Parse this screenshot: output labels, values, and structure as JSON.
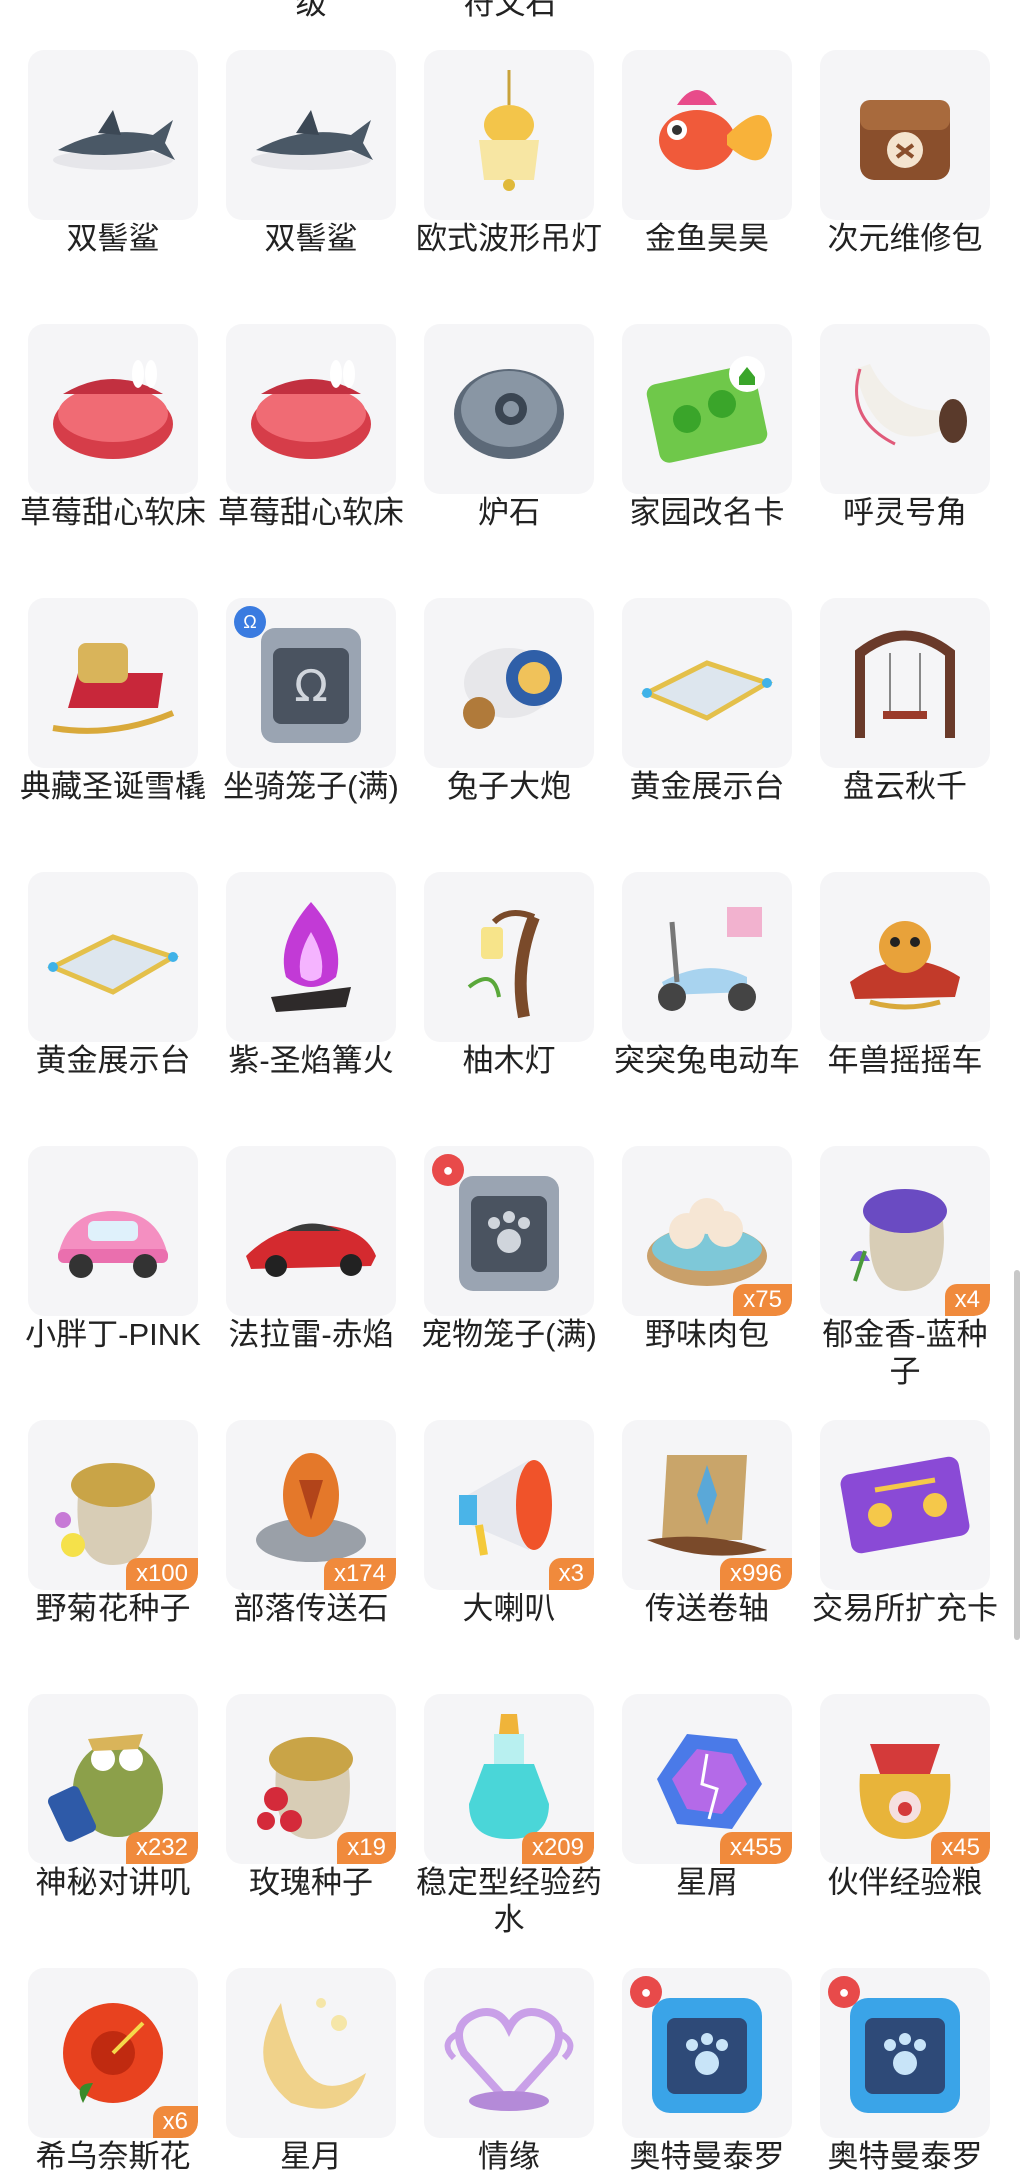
{
  "header_partial": {
    "left": "级",
    "middle": "符文石"
  },
  "items": [
    {
      "name": "双髻鲨",
      "icon": "shark-icon"
    },
    {
      "name": "双髻鲨",
      "icon": "shark-icon"
    },
    {
      "name": "欧式波形吊灯",
      "icon": "chandelier-icon"
    },
    {
      "name": "金鱼昊昊",
      "icon": "goldfish-icon"
    },
    {
      "name": "次元维修包",
      "icon": "repair-bag-icon"
    },
    {
      "name": "草莓甜心软床",
      "icon": "strawberry-bed-icon"
    },
    {
      "name": "草莓甜心软床",
      "icon": "strawberry-bed-icon"
    },
    {
      "name": "炉石",
      "icon": "hearthstone-icon"
    },
    {
      "name": "家园改名卡",
      "icon": "rename-card-icon"
    },
    {
      "name": "呼灵号角",
      "icon": "horn-icon"
    },
    {
      "name": "典藏圣诞雪橇",
      "icon": "sleigh-icon"
    },
    {
      "name": "坐骑笼子(满)",
      "icon": "mount-cage-icon",
      "corner": "mount"
    },
    {
      "name": "兔子大炮",
      "icon": "cannon-icon"
    },
    {
      "name": "黄金展示台",
      "icon": "display-stand-icon"
    },
    {
      "name": "盘云秋千",
      "icon": "swing-icon"
    },
    {
      "name": "黄金展示台",
      "icon": "display-stand-icon"
    },
    {
      "name": "紫-圣焰篝火",
      "icon": "bonfire-icon"
    },
    {
      "name": "柚木灯",
      "icon": "teak-lamp-icon"
    },
    {
      "name": "突突兔电动车",
      "icon": "scooter-icon"
    },
    {
      "name": "年兽摇摇车",
      "icon": "rocking-car-icon"
    },
    {
      "name": "小胖丁-PINK",
      "icon": "pink-car-icon"
    },
    {
      "name": "法拉雷-赤焰",
      "icon": "red-sportscar-icon"
    },
    {
      "name": "宠物笼子(满)",
      "icon": "pet-cage-icon",
      "corner": "pet"
    },
    {
      "name": "野味肉包",
      "icon": "steamed-bun-icon",
      "badge": "x75"
    },
    {
      "name": "郁金香-蓝种子",
      "icon": "tulip-seed-bag-icon",
      "badge": "x4"
    },
    {
      "name": "野菊花种子",
      "icon": "chrysanthemum-seed-bag-icon",
      "badge": "x100"
    },
    {
      "name": "部落传送石",
      "icon": "teleport-stone-icon",
      "badge": "x174"
    },
    {
      "name": "大喇叭",
      "icon": "megaphone-icon",
      "badge": "x3"
    },
    {
      "name": "传送卷轴",
      "icon": "scroll-icon",
      "badge": "x996"
    },
    {
      "name": "交易所扩充卡",
      "icon": "exchange-card-icon"
    },
    {
      "name": "神秘对讲叽",
      "icon": "walkie-talkie-bird-icon",
      "badge": "x232"
    },
    {
      "name": "玫瑰种子",
      "icon": "rose-seed-bag-icon",
      "badge": "x19"
    },
    {
      "name": "稳定型经验药水",
      "icon": "potion-icon",
      "badge": "x209"
    },
    {
      "name": "星屑",
      "icon": "stardust-icon",
      "badge": "x455"
    },
    {
      "name": "伙伴经验粮",
      "icon": "food-bag-icon",
      "badge": "x45"
    },
    {
      "name": "希乌奈斯花",
      "icon": "hibiscus-icon",
      "badge": "x6"
    },
    {
      "name": "星月",
      "icon": "moon-icon"
    },
    {
      "name": "情缘",
      "icon": "heart-frame-icon"
    },
    {
      "name": "奥特曼泰罗",
      "icon": "blue-pet-cage-icon",
      "corner": "pet"
    },
    {
      "name": "奥特曼泰罗",
      "icon": "blue-pet-cage-icon",
      "corner": "pet"
    }
  ],
  "colors": {
    "tile_bg": "#f5f5f7",
    "badge_bg": "#f08a3c",
    "text": "#222222"
  }
}
